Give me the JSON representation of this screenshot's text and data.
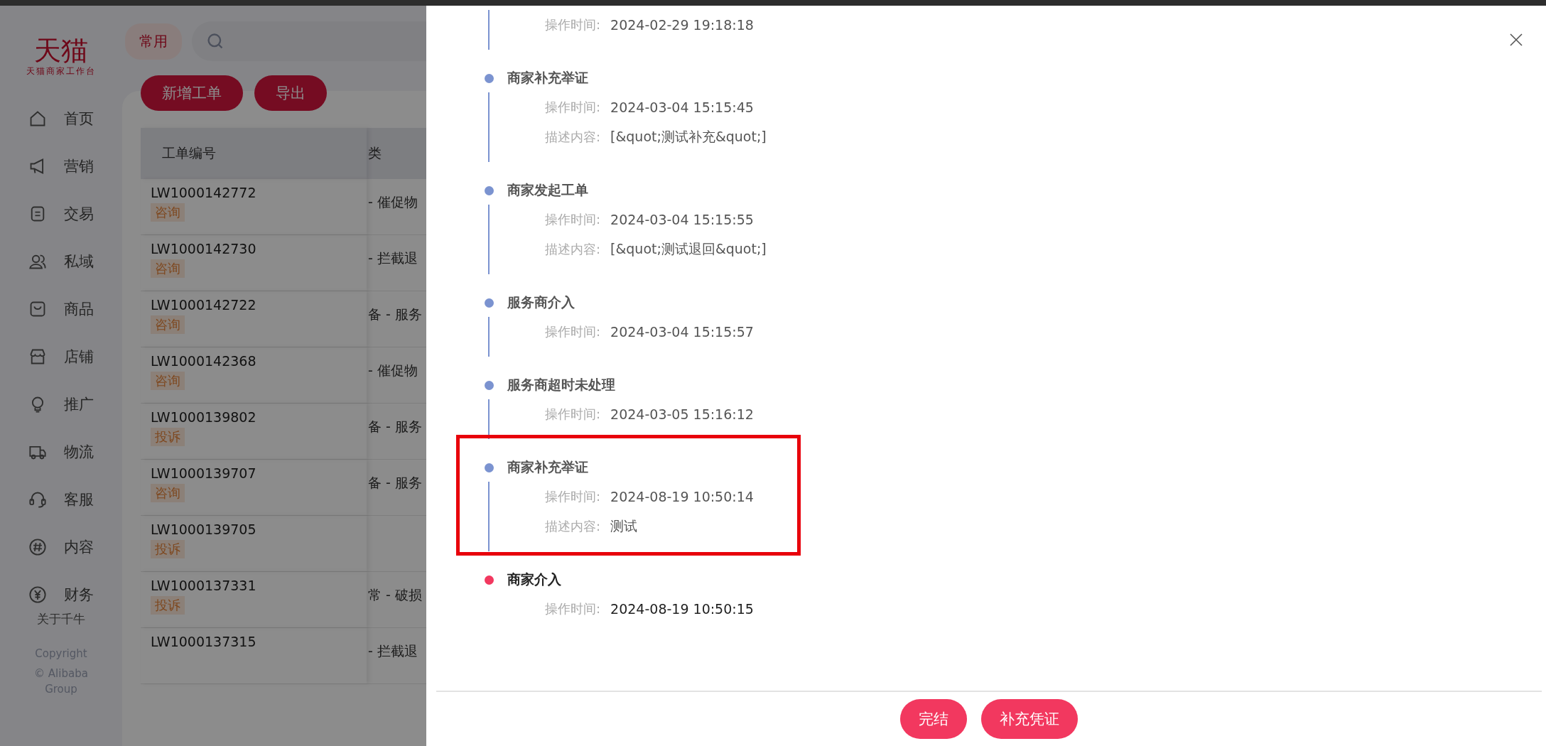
{
  "app": {
    "logo": "天猫",
    "logo_subtitle": "天猫商家工作台",
    "favorites_button": "常用",
    "nav": [
      {
        "label": "首页"
      },
      {
        "label": "营销"
      },
      {
        "label": "交易"
      },
      {
        "label": "私域"
      },
      {
        "label": "商品"
      },
      {
        "label": "店铺"
      },
      {
        "label": "推广"
      },
      {
        "label": "物流"
      },
      {
        "label": "客服"
      },
      {
        "label": "内容"
      },
      {
        "label": "财务"
      }
    ],
    "about_link": "关于千牛",
    "copyright": "Copyright",
    "copyright_owner": "© Alibaba Group",
    "actions": [
      "新增工单",
      "导出"
    ],
    "table": {
      "columns": [
        "工单编号",
        "类"
      ],
      "rows": [
        {
          "id": "LW1000142772",
          "tag": "咨询",
          "column_2": "- 催促物"
        },
        {
          "id": "LW1000142730",
          "tag": "咨询",
          "column_2": "- 拦截退"
        },
        {
          "id": "LW1000142722",
          "tag": "咨询",
          "column_2": "备 - 服务"
        },
        {
          "id": "LW1000142368",
          "tag": "咨询",
          "column_2": "- 催促物"
        },
        {
          "id": "LW1000139802",
          "tag": "投诉",
          "column_2": "备 - 服务"
        },
        {
          "id": "LW1000139707",
          "tag": "咨询",
          "column_2": "备 - 服务"
        },
        {
          "id": "LW1000139705",
          "tag": "投诉"
        },
        {
          "id": "LW1000137331",
          "tag": "投诉",
          "column_2": "常 - 破损"
        },
        {
          "id": "LW1000137315",
          "column_2": "- 拦截退"
        }
      ]
    }
  },
  "drawer": {
    "events": [
      {
        "current": false,
        "highlighted": false,
        "fields": [
          {
            "label": "操作时间:",
            "value": "2024-02-29 19:18:18"
          }
        ]
      },
      {
        "title": "商家补充举证",
        "current": false,
        "highlighted": false,
        "fields": [
          {
            "label": "操作时间:",
            "value": "2024-03-04 15:15:45"
          },
          {
            "label": "描述内容:",
            "value": "[&quot;测试补充&quot;]"
          }
        ]
      },
      {
        "title": "商家发起工单",
        "current": false,
        "highlighted": false,
        "fields": [
          {
            "label": "操作时间:",
            "value": "2024-03-04 15:15:55"
          },
          {
            "label": "描述内容:",
            "value": "[&quot;测试退回&quot;]"
          }
        ]
      },
      {
        "title": "服务商介入",
        "current": false,
        "highlighted": false,
        "fields": [
          {
            "label": "操作时间:",
            "value": "2024-03-04 15:15:57"
          }
        ]
      },
      {
        "title": "服务商超时未处理",
        "current": false,
        "highlighted": false,
        "fields": [
          {
            "label": "操作时间:",
            "value": "2024-03-05 15:16:12"
          }
        ]
      },
      {
        "title": "商家补充举证",
        "current": false,
        "highlighted": true,
        "fields": [
          {
            "label": "操作时间:",
            "value": "2024-08-19 10:50:14"
          },
          {
            "label": "描述内容:",
            "value": "测试"
          }
        ]
      },
      {
        "title": "商家介入",
        "current": true,
        "highlighted": false,
        "fields": [
          {
            "label": "操作时间:",
            "value": "2024-08-19 10:50:15"
          }
        ]
      }
    ],
    "buttons": [
      "完结",
      "补充凭证"
    ]
  }
}
